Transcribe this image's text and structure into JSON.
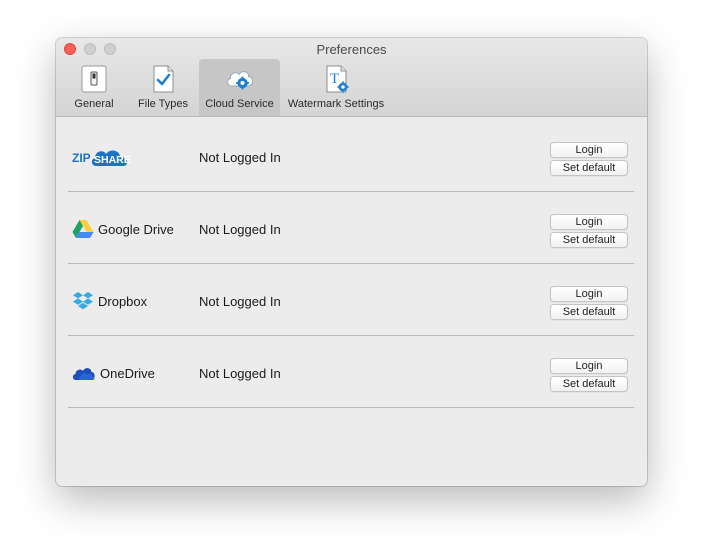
{
  "window": {
    "title": "Preferences"
  },
  "toolbar": {
    "tabs": [
      {
        "label": "General",
        "icon": "switch-icon",
        "selected": false
      },
      {
        "label": "File Types",
        "icon": "document-check-icon",
        "selected": false
      },
      {
        "label": "Cloud Service",
        "icon": "cloud-gear-icon",
        "selected": true
      },
      {
        "label": "Watermark Settings",
        "icon": "text-gear-icon",
        "selected": false
      }
    ]
  },
  "services": [
    {
      "name": "ZIPSHARE",
      "logo_text_1": "ZIP",
      "logo_text_2": "SHARE",
      "status": "Not Logged In",
      "login_label": "Login",
      "default_label": "Set default"
    },
    {
      "name": "Google Drive",
      "status": "Not Logged In",
      "login_label": "Login",
      "default_label": "Set default"
    },
    {
      "name": "Dropbox",
      "status": "Not Logged In",
      "login_label": "Login",
      "default_label": "Set default"
    },
    {
      "name": "OneDrive",
      "status": "Not Logged In",
      "login_label": "Login",
      "default_label": "Set default"
    }
  ],
  "colors": {
    "close": "#fc5f57",
    "accent_blue": "#1f7fd8",
    "zipshare_blue": "#1a73c9",
    "gdrive_green": "#1ea362",
    "gdrive_yellow": "#ffcd40",
    "gdrive_blue": "#4688f4",
    "dropbox_blue": "#35a9e0",
    "onedrive_blue": "#1d4fb8"
  }
}
